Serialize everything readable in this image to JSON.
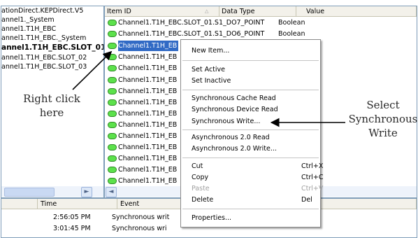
{
  "tree": {
    "items": [
      {
        "label": "ationDirect.KEPDirect.V5",
        "bold": false
      },
      {
        "label": "annel1._System",
        "bold": false
      },
      {
        "label": "annel1.T1H_EBC",
        "bold": false
      },
      {
        "label": "annel1.T1H_EBC._System",
        "bold": false
      },
      {
        "label": "annel1.T1H_EBC.SLOT_01",
        "bold": true
      },
      {
        "label": "annel1.T1H_EBC.SLOT_02",
        "bold": false
      },
      {
        "label": "annel1.T1H_EBC.SLOT_03",
        "bold": false
      }
    ]
  },
  "list": {
    "columns": [
      "Item ID",
      "Data Type",
      "Value"
    ],
    "rows": [
      {
        "item": "Channel1.T1H_EBC.SLOT_01.S1_DO7_POINT",
        "type": "Boolean"
      },
      {
        "item": "Channel1.T1H_EBC.SLOT_01.S1_DO6_POINT",
        "type": "Boolean"
      },
      {
        "item": "Channel1.T1H_EB",
        "type": ""
      },
      {
        "item": "Channel1.T1H_EB",
        "type": ""
      },
      {
        "item": "Channel1.T1H_EB",
        "type": ""
      },
      {
        "item": "Channel1.T1H_EB",
        "type": ""
      },
      {
        "item": "Channel1.T1H_EB",
        "type": ""
      },
      {
        "item": "Channel1.T1H_EB",
        "type": ""
      },
      {
        "item": "Channel1.T1H_EB",
        "type": ""
      },
      {
        "item": "Channel1.T1H_EB",
        "type": ""
      },
      {
        "item": "Channel1.T1H_EB",
        "type": ""
      },
      {
        "item": "Channel1.T1H_EB",
        "type": ""
      },
      {
        "item": "Channel1.T1H_EB",
        "type": ""
      },
      {
        "item": "Channel1.T1H_EB",
        "type": ""
      },
      {
        "item": "Channel1.T1H_EB",
        "type": ""
      }
    ],
    "selected_index": 2
  },
  "events": {
    "columns": [
      "Time",
      "Event"
    ],
    "rows": [
      {
        "time": "2:56:05 PM",
        "event": "Synchronous writ"
      },
      {
        "time": "3:01:45 PM",
        "event": "Synchronous wri"
      }
    ]
  },
  "context_menu": {
    "items": [
      {
        "label": "New Item...",
        "shortcut": "",
        "disabled": false
      },
      {
        "label": "Set Active",
        "shortcut": "",
        "disabled": false
      },
      {
        "label": "Set Inactive",
        "shortcut": "",
        "disabled": false
      },
      {
        "label": "Synchronous Cache Read",
        "shortcut": "",
        "disabled": false
      },
      {
        "label": "Synchronous Device Read",
        "shortcut": "",
        "disabled": false
      },
      {
        "label": "Synchronous Write...",
        "shortcut": "",
        "disabled": false
      },
      {
        "label": "Asynchronous 2.0 Read",
        "shortcut": "",
        "disabled": false
      },
      {
        "label": "Asynchronous 2.0 Write...",
        "shortcut": "",
        "disabled": false
      },
      {
        "label": "Cut",
        "shortcut": "Ctrl+X",
        "disabled": false
      },
      {
        "label": "Copy",
        "shortcut": "Ctrl+C",
        "disabled": false
      },
      {
        "label": "Paste",
        "shortcut": "Ctrl+V",
        "disabled": true
      },
      {
        "label": "Delete",
        "shortcut": "Del",
        "disabled": false
      },
      {
        "label": "Properties...",
        "shortcut": "",
        "disabled": false
      }
    ]
  },
  "callouts": {
    "left": [
      "Right click",
      "here"
    ],
    "right": [
      "Select",
      "Synchronous",
      "Write"
    ]
  },
  "colors": {
    "selection": "#316ac5",
    "tag_green": "#5ce14b",
    "menu_border": "#8a8a8a"
  },
  "icons": {
    "tag": "green-tag-icon",
    "scroll_left": "chevron-left-icon",
    "scroll_right": "chevron-right-icon"
  }
}
